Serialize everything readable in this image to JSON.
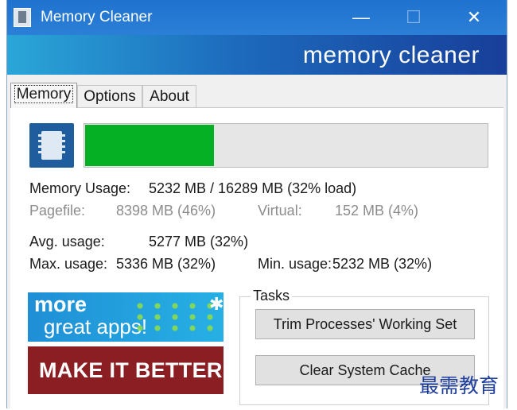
{
  "window": {
    "title": "Memory Cleaner",
    "minimize_glyph": "—",
    "maximize_glyph": "☐",
    "close_glyph": "✕"
  },
  "banner": {
    "text": "memory cleaner"
  },
  "tabs": [
    {
      "label": "Memory"
    },
    {
      "label": "Options"
    },
    {
      "label": "About"
    }
  ],
  "memory": {
    "usage_percent": 32,
    "usage_label": "Memory Usage:",
    "usage_value": "5232 MB / 16289 MB  (32% load)",
    "pagefile_label": "Pagefile:",
    "pagefile_value": "8398 MB (46%)",
    "virtual_label": "Virtual:",
    "virtual_value": "152 MB (4%)",
    "avg_label": "Avg. usage:",
    "avg_value": "5277 MB (32%)",
    "max_label": "Max. usage:",
    "max_value": "5336 MB (32%)",
    "min_label": "Min. usage:",
    "min_value": "5232 MB (32%)"
  },
  "ads": {
    "line1": "more",
    "line2": "great apps!",
    "better": "MAKE IT BETTER"
  },
  "tasks": {
    "legend": "Tasks",
    "trim_label": "Trim Processes' Working Set",
    "clear_label": "Clear System Cache"
  },
  "watermark": "最需教育",
  "colors": {
    "progress_fill": "#06b025",
    "titlebar": "#2b7cd3"
  }
}
